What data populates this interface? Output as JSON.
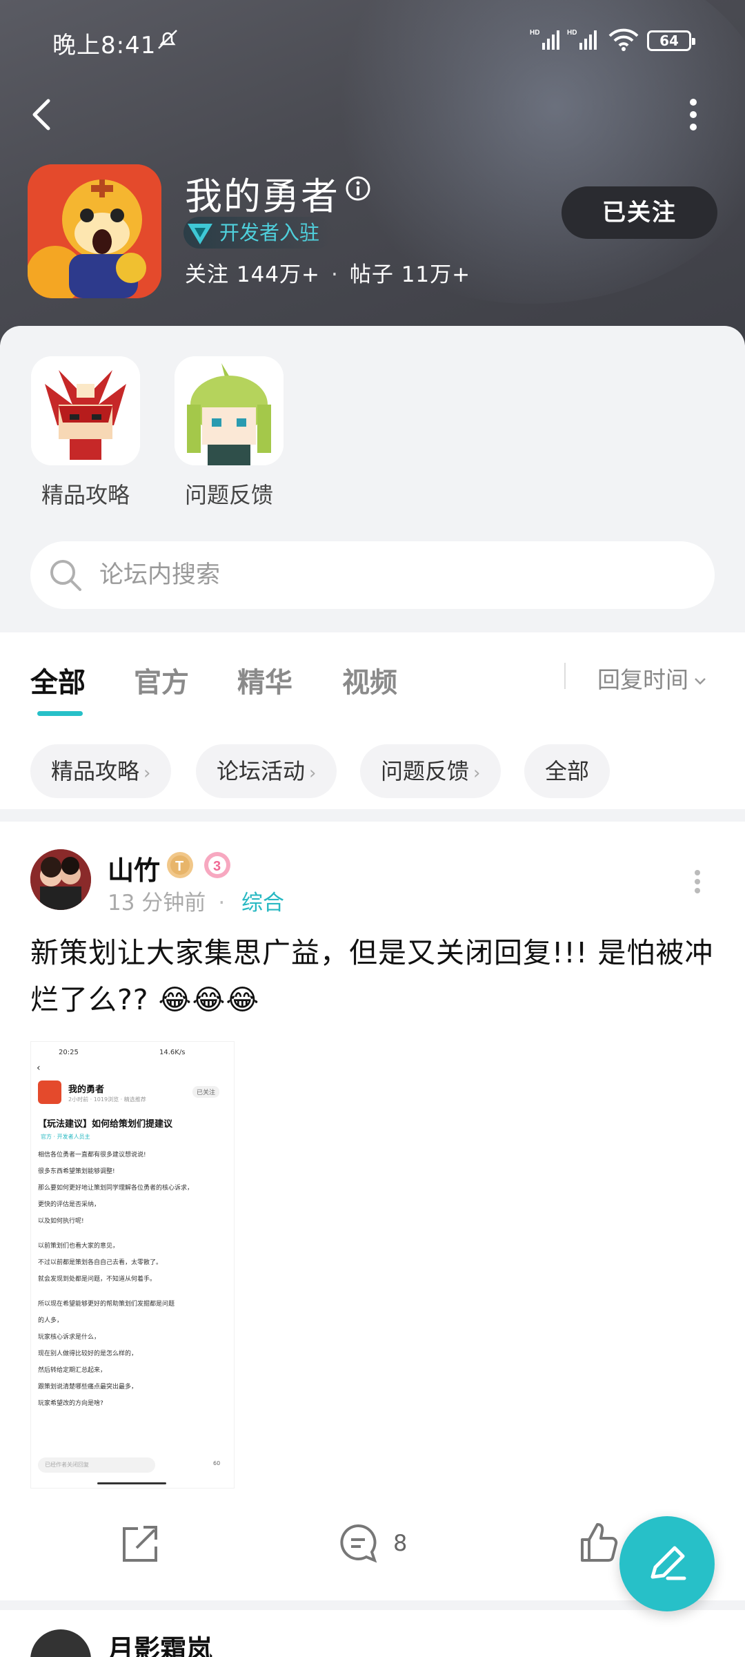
{
  "status_bar": {
    "time": "晚上8:41",
    "battery": "64"
  },
  "forum": {
    "title": "我的勇者",
    "developer_badge": "开发者入驻",
    "followers_label": "关注 144万+",
    "posts_label": "帖子 11万+",
    "stats_separator": "·",
    "follow_button": "已关注"
  },
  "shortcuts": [
    {
      "label": "精品攻略",
      "icon": "red-mask-pixel-character-icon"
    },
    {
      "label": "问题反馈",
      "icon": "green-hair-pixel-character-icon"
    }
  ],
  "search": {
    "placeholder": "论坛内搜索"
  },
  "tabs": [
    {
      "label": "全部",
      "active": true
    },
    {
      "label": "官方",
      "active": false
    },
    {
      "label": "精华",
      "active": false
    },
    {
      "label": "视频",
      "active": false
    }
  ],
  "sort": {
    "label": "回复时间"
  },
  "chips": [
    {
      "label": "精品攻略",
      "chevron": "›"
    },
    {
      "label": "论坛活动",
      "chevron": "›"
    },
    {
      "label": "问题反馈",
      "chevron": "›"
    },
    {
      "label": "全部"
    }
  ],
  "post": {
    "author": "山竹",
    "time": "13 分钟前",
    "separator": "·",
    "category": "综合",
    "text": "新策划让大家集思广益，但是又关闭回复!!! 是怕被冲烂了么?? 😂😂😂",
    "comment_count": "8",
    "screenshot": {
      "status_time": "20:25",
      "status_right": "14.6K/s",
      "forum_name": "我的勇者",
      "meta": "2小时前 · 1019浏览 · 精选推荐",
      "follow": "已关注",
      "post_title": "【玩法建议】如何给策划们提建议",
      "tags": "官方 · 开发者人员主",
      "lines": [
        "相信各位勇者一直都有很多建议想说说!",
        "很多东西希望策划能够调整!",
        "那么要如何更好地让策划同学理解各位勇者的核心诉求，",
        "更快的评估是否采纳，",
        "以及如何执行呢!",
        "以前策划们也看大家的意见，",
        "不过以前都是策划各自自己去看，太零散了。",
        "就会发现到处都是问题，不知道从何着手。",
        "所以现在希望能够更好的帮助策划们发掘都是问题",
        "的人多，",
        "玩家核心诉求是什么，",
        "现在别人做得比较好的是怎么样的，",
        "然后转给定期汇总起来，",
        "跟策划说清楚哪些痛点最突出最多，",
        "玩家希望改的方向是啥?"
      ],
      "reply_placeholder": "已经作者关闭回复",
      "like_count": "60"
    }
  },
  "next_post": {
    "author": "月影霜岚"
  },
  "colors": {
    "accent": "#27c0c8",
    "header_bg": "#4a4b52",
    "follow_button_bg": "#2a2b30"
  }
}
